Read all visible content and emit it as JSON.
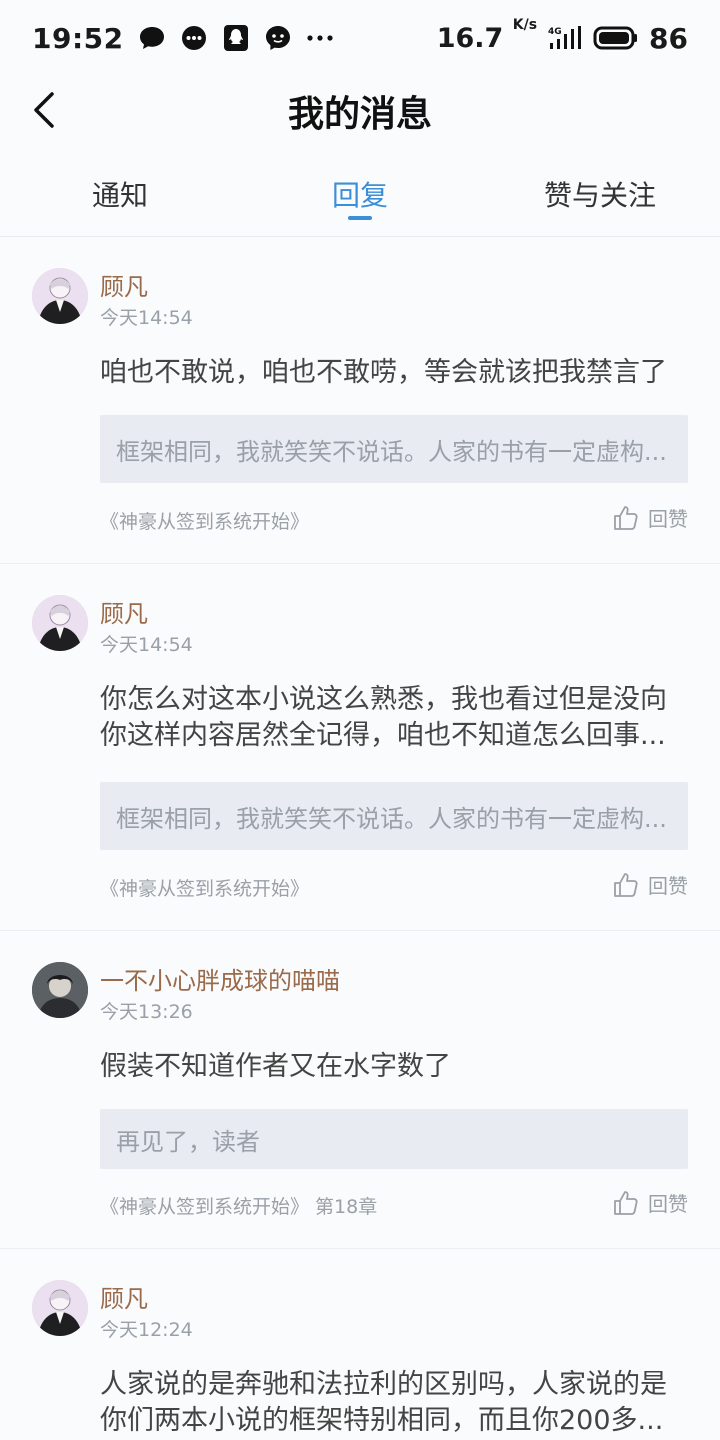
{
  "status_bar": {
    "time": "19:52",
    "app_icons": [
      "chat-bubble-icon",
      "message-dots-icon",
      "qq-penguin-icon",
      "messenger-icon",
      "more-dots-icon"
    ],
    "net_speed": "16.7",
    "net_unit": "K/s",
    "network_label": "4G",
    "battery": "86"
  },
  "header": {
    "title": "我的消息"
  },
  "tabs": [
    {
      "label": "通知",
      "active": false
    },
    {
      "label": "回复",
      "active": true
    },
    {
      "label": "赞与关注",
      "active": false
    }
  ],
  "messages": [
    {
      "username": "顾凡",
      "time": "今天14:54",
      "text": "咱也不敢说，咱也不敢唠，等会就该把我禁言了",
      "quote": "框架相同，我就笑笑不说话。人家的书有一定虚构...",
      "book": "《神豪从签到系统开始》",
      "like_label": "回赞"
    },
    {
      "username": "顾凡",
      "time": "今天14:54",
      "text": "你怎么对这本小说这么熟悉，我也看过但是没向你这样内容居然全记得，咱也不知道怎么回事...",
      "quote": "框架相同，我就笑笑不说话。人家的书有一定虚构...",
      "book": "《神豪从签到系统开始》",
      "like_label": "回赞"
    },
    {
      "username": "一不小心胖成球的喵喵",
      "time": "今天13:26",
      "text": "假装不知道作者又在水字数了",
      "quote": "再见了，读者",
      "book": "《神豪从签到系统开始》 第18章",
      "like_label": "回赞"
    },
    {
      "username": "顾凡",
      "time": "今天12:24",
      "text": "人家说的是奔驰和法拉利的区别吗，人家说的是你们两本小说的框架特别相同，而且你200多...",
      "quote": "",
      "book": "",
      "like_label": ""
    }
  ],
  "colors": {
    "accent": "#3b8ed8",
    "username": "#9a6a4a",
    "muted": "#9aa0a8",
    "quote_bg": "#e8ebf2"
  }
}
